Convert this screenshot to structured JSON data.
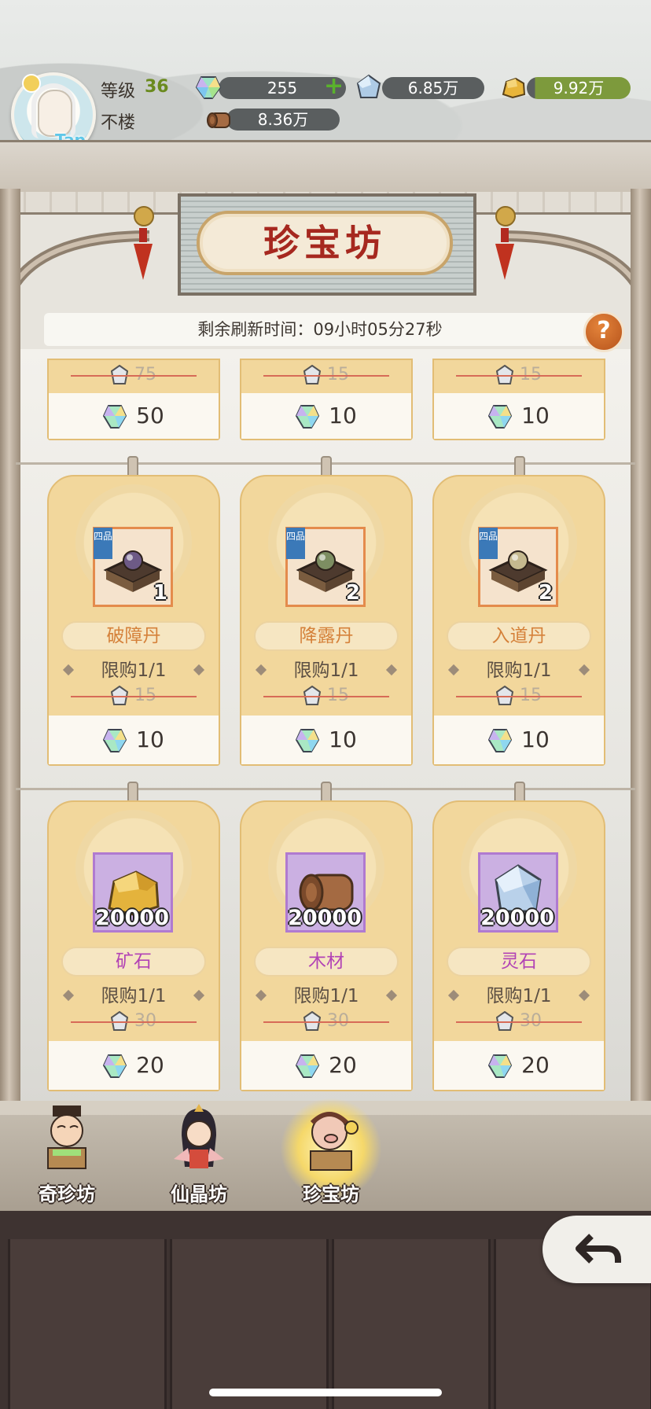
{
  "player": {
    "level_label": "等级",
    "level_value": "36",
    "realm": "不楼",
    "avatar_badge": "Tap"
  },
  "currencies": [
    {
      "icon": "jade-gem-icon",
      "value": "255",
      "has_add": true
    },
    {
      "icon": "spirit-stone-icon",
      "value": "6.85万"
    },
    {
      "icon": "gold-ore-icon",
      "value": "9.92万"
    },
    {
      "icon": "wood-log-icon",
      "value": "8.36万"
    }
  ],
  "shop": {
    "title": "珍宝坊",
    "refresh_label": "剩余刷新时间：",
    "refresh_time": "09小时05分27秒",
    "help": "?"
  },
  "partial_row": [
    {
      "original_price": "75",
      "price": "50"
    },
    {
      "original_price": "15",
      "price": "10"
    },
    {
      "original_price": "15",
      "price": "10"
    }
  ],
  "items": [
    {
      "name": "破障丹",
      "qty": "1",
      "grade": "四品",
      "icon": "pill-cauldron-icon",
      "orb": "#6d5a86",
      "limit": "限购1/1",
      "original_price": "15",
      "price": "10",
      "name_color": "orange",
      "box": "orange"
    },
    {
      "name": "降露丹",
      "qty": "2",
      "grade": "四品",
      "icon": "pill-cauldron-icon",
      "orb": "#7d8e62",
      "limit": "限购1/1",
      "original_price": "15",
      "price": "10",
      "name_color": "orange",
      "box": "orange"
    },
    {
      "name": "入道丹",
      "qty": "2",
      "grade": "四品",
      "icon": "pill-cauldron-icon",
      "orb": "#c5b98f",
      "limit": "限购1/1",
      "original_price": "15",
      "price": "10",
      "name_color": "orange",
      "box": "orange"
    },
    {
      "name": "矿石",
      "qty": "20000",
      "icon": "gold-ore-icon",
      "limit": "限购1/1",
      "original_price": "30",
      "price": "20",
      "name_color": "purple",
      "box": "purple"
    },
    {
      "name": "木材",
      "qty": "20000",
      "icon": "wood-log-icon",
      "limit": "限购1/1",
      "original_price": "30",
      "price": "20",
      "name_color": "purple",
      "box": "purple"
    },
    {
      "name": "灵石",
      "qty": "20000",
      "icon": "spirit-stone-icon",
      "limit": "限购1/1",
      "original_price": "30",
      "price": "20",
      "name_color": "purple",
      "box": "purple"
    }
  ],
  "tabs": [
    {
      "label": "奇珍坊",
      "active": false
    },
    {
      "label": "仙晶坊",
      "active": false
    },
    {
      "label": "珍宝坊",
      "active": true
    }
  ],
  "colors": {
    "title_red": "#a6281f",
    "card_bg": "#f2d79c",
    "name_orange": "#d5813a",
    "name_purple": "#b243b5",
    "strike_red": "#d76b57"
  }
}
